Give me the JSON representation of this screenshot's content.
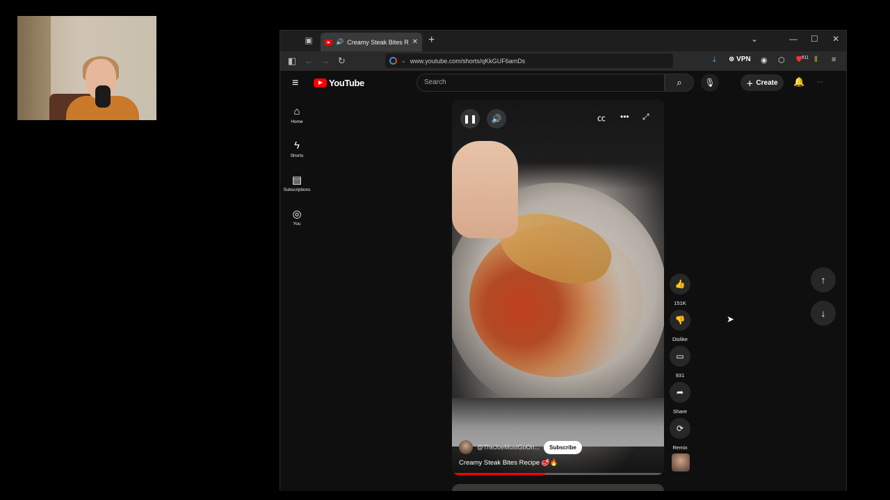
{
  "browser": {
    "tab_title": "Creamy Steak Bites Recipe",
    "url": "www.youtube.com/shorts/qKkGUF6amDs",
    "vpn_label": "VPN",
    "ext_badge": "611"
  },
  "youtube": {
    "logo": "YouTube",
    "search_placeholder": "Search",
    "create_label": "Create",
    "sidebar": [
      {
        "label": "Home",
        "icon": "home-icon"
      },
      {
        "label": "Shorts",
        "icon": "shorts-icon"
      },
      {
        "label": "Subscriptions",
        "icon": "subscriptions-icon"
      },
      {
        "label": "You",
        "icon": "user-icon"
      }
    ],
    "short": {
      "channel": "@TheJoeMustGoOn...",
      "subscribe_label": "Subscribe",
      "title": "Creamy Steak Bites Recipe 🥩🔥",
      "progress": 0.44
    },
    "actions": [
      {
        "label": "151K",
        "icon": "thumbs-up-icon"
      },
      {
        "label": "Dislike",
        "icon": "thumbs-down-icon"
      },
      {
        "label": "931",
        "icon": "comment-icon"
      },
      {
        "label": "Share",
        "icon": "share-icon"
      },
      {
        "label": "Remix",
        "icon": "remix-icon"
      }
    ]
  }
}
